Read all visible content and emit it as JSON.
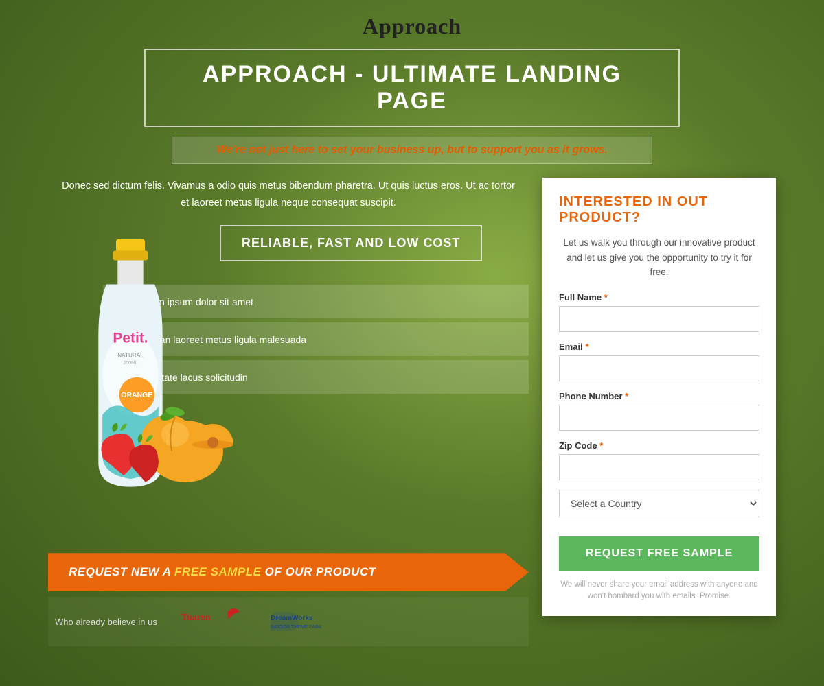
{
  "site": {
    "logo": "Approach"
  },
  "hero": {
    "title": "APPROACH - ULTIMATE LANDING PAGE",
    "subtitle": "We're not just here to set your business up, but to support you as it grows.",
    "description": "Donec sed dictum felis. Vivamus a odio quis metus bibendum pharetra. Ut quis luctus eros. Ut ac tortor et laoreet metus ligula neque consequat suscipit.",
    "cta_button": "RELIABLE, FAST AND LOW COST"
  },
  "features": [
    {
      "text": "Lorem ipsum dolor sit amet"
    },
    {
      "text": "Aenean laoreet metus ligula malesuada"
    },
    {
      "text": "Vulputate lacus solicitudin"
    }
  ],
  "banner": {
    "prefix": "REQUEST NEW A ",
    "highlight": "FREE SAMPLE",
    "suffix": " OF OUR PRODUCT"
  },
  "brands": {
    "label": "Who already believe in us",
    "items": [
      "Tuaren",
      "DreamWorks Indoor Theme Park"
    ]
  },
  "form": {
    "title": "INTERESTED IN OUT PRODUCT?",
    "intro": "Let us walk you through our innovative product and let us give you the opportunity to try it for free.",
    "fields": {
      "full_name_label": "Full Name",
      "email_label": "Email",
      "phone_label": "Phone Number",
      "zip_label": "Zip Code",
      "country_placeholder": "Select a Country"
    },
    "submit_label": "REQUEST FREE SAMPLE",
    "disclaimer": "We will never share your email address with anyone and won't bombard you with emails. Promise.",
    "required_marker": "*"
  }
}
